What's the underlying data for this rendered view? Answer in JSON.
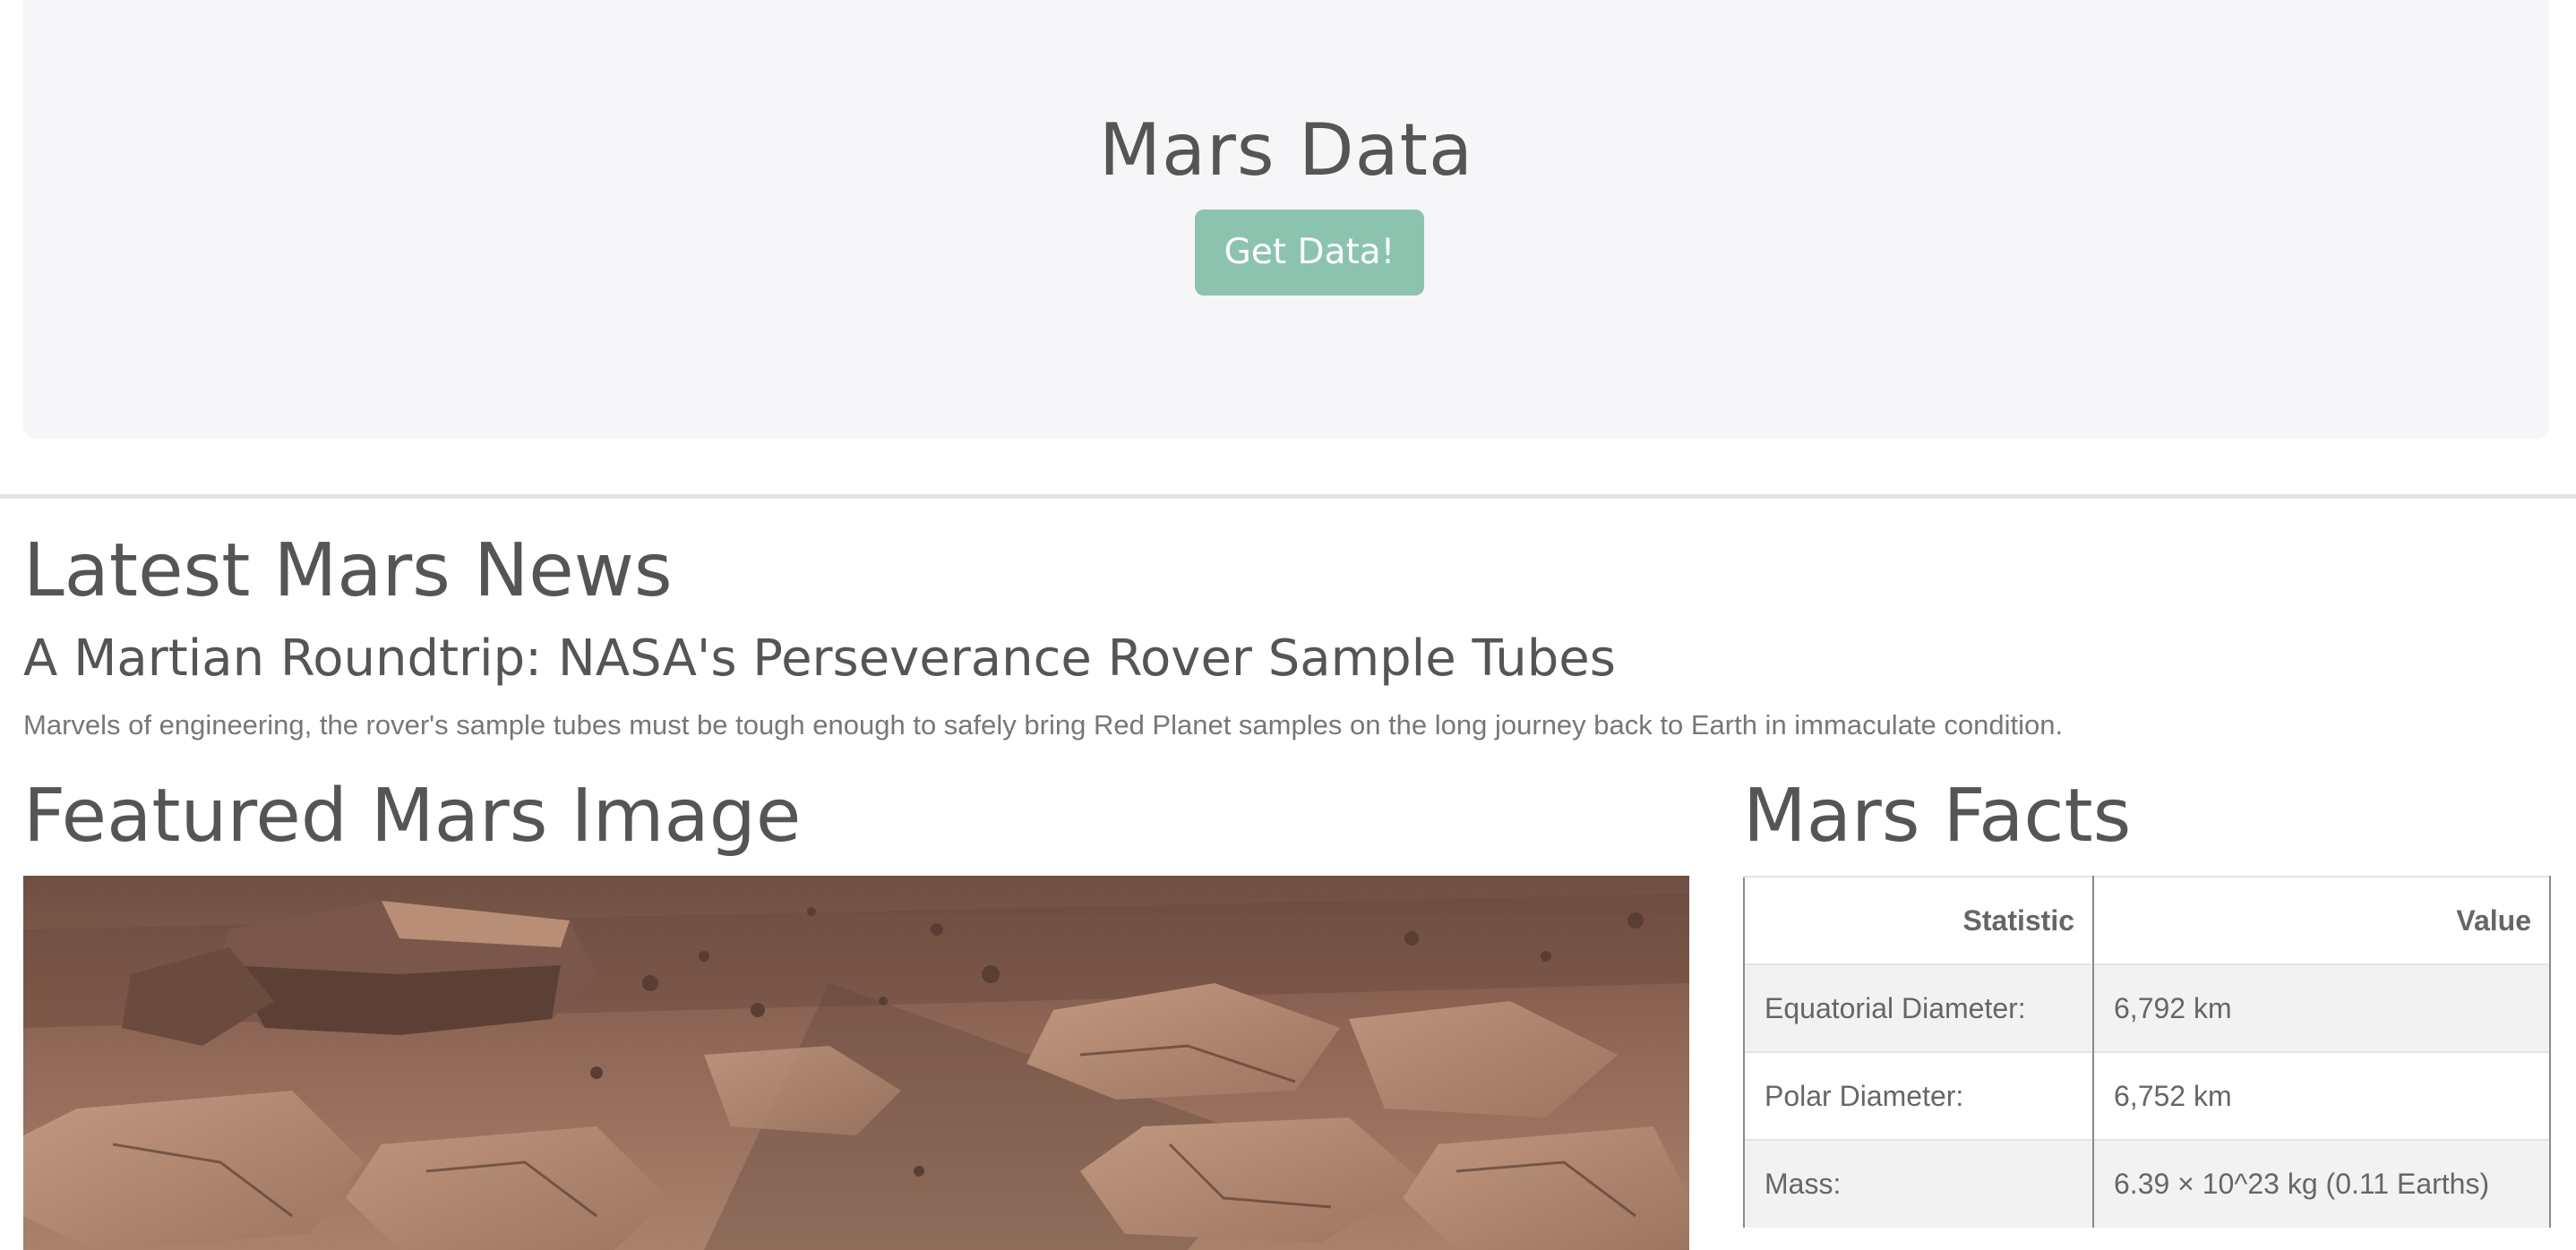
{
  "jumbotron": {
    "title": "Mars Data",
    "button_label": "Get Data!",
    "button_color": "#8cc3ae"
  },
  "news": {
    "heading": "Latest Mars News",
    "title": "A Martian Roundtrip: NASA's Perseverance Rover Sample Tubes",
    "teaser": "Marvels of engineering, the rover's sample tubes must be tough enough to safely bring Red Planet samples on the long journey back to Earth in immaculate condition."
  },
  "featured_image": {
    "heading": "Featured Mars Image"
  },
  "facts": {
    "heading": "Mars Facts",
    "columns": [
      "Statistic",
      "Value"
    ],
    "rows": [
      [
        "Equatorial Diameter:",
        "6,792 km"
      ],
      [
        "Polar Diameter:",
        "6,752 km"
      ],
      [
        "Mass:",
        "6.39 × 10^23 kg (0.11 Earths)"
      ]
    ]
  }
}
